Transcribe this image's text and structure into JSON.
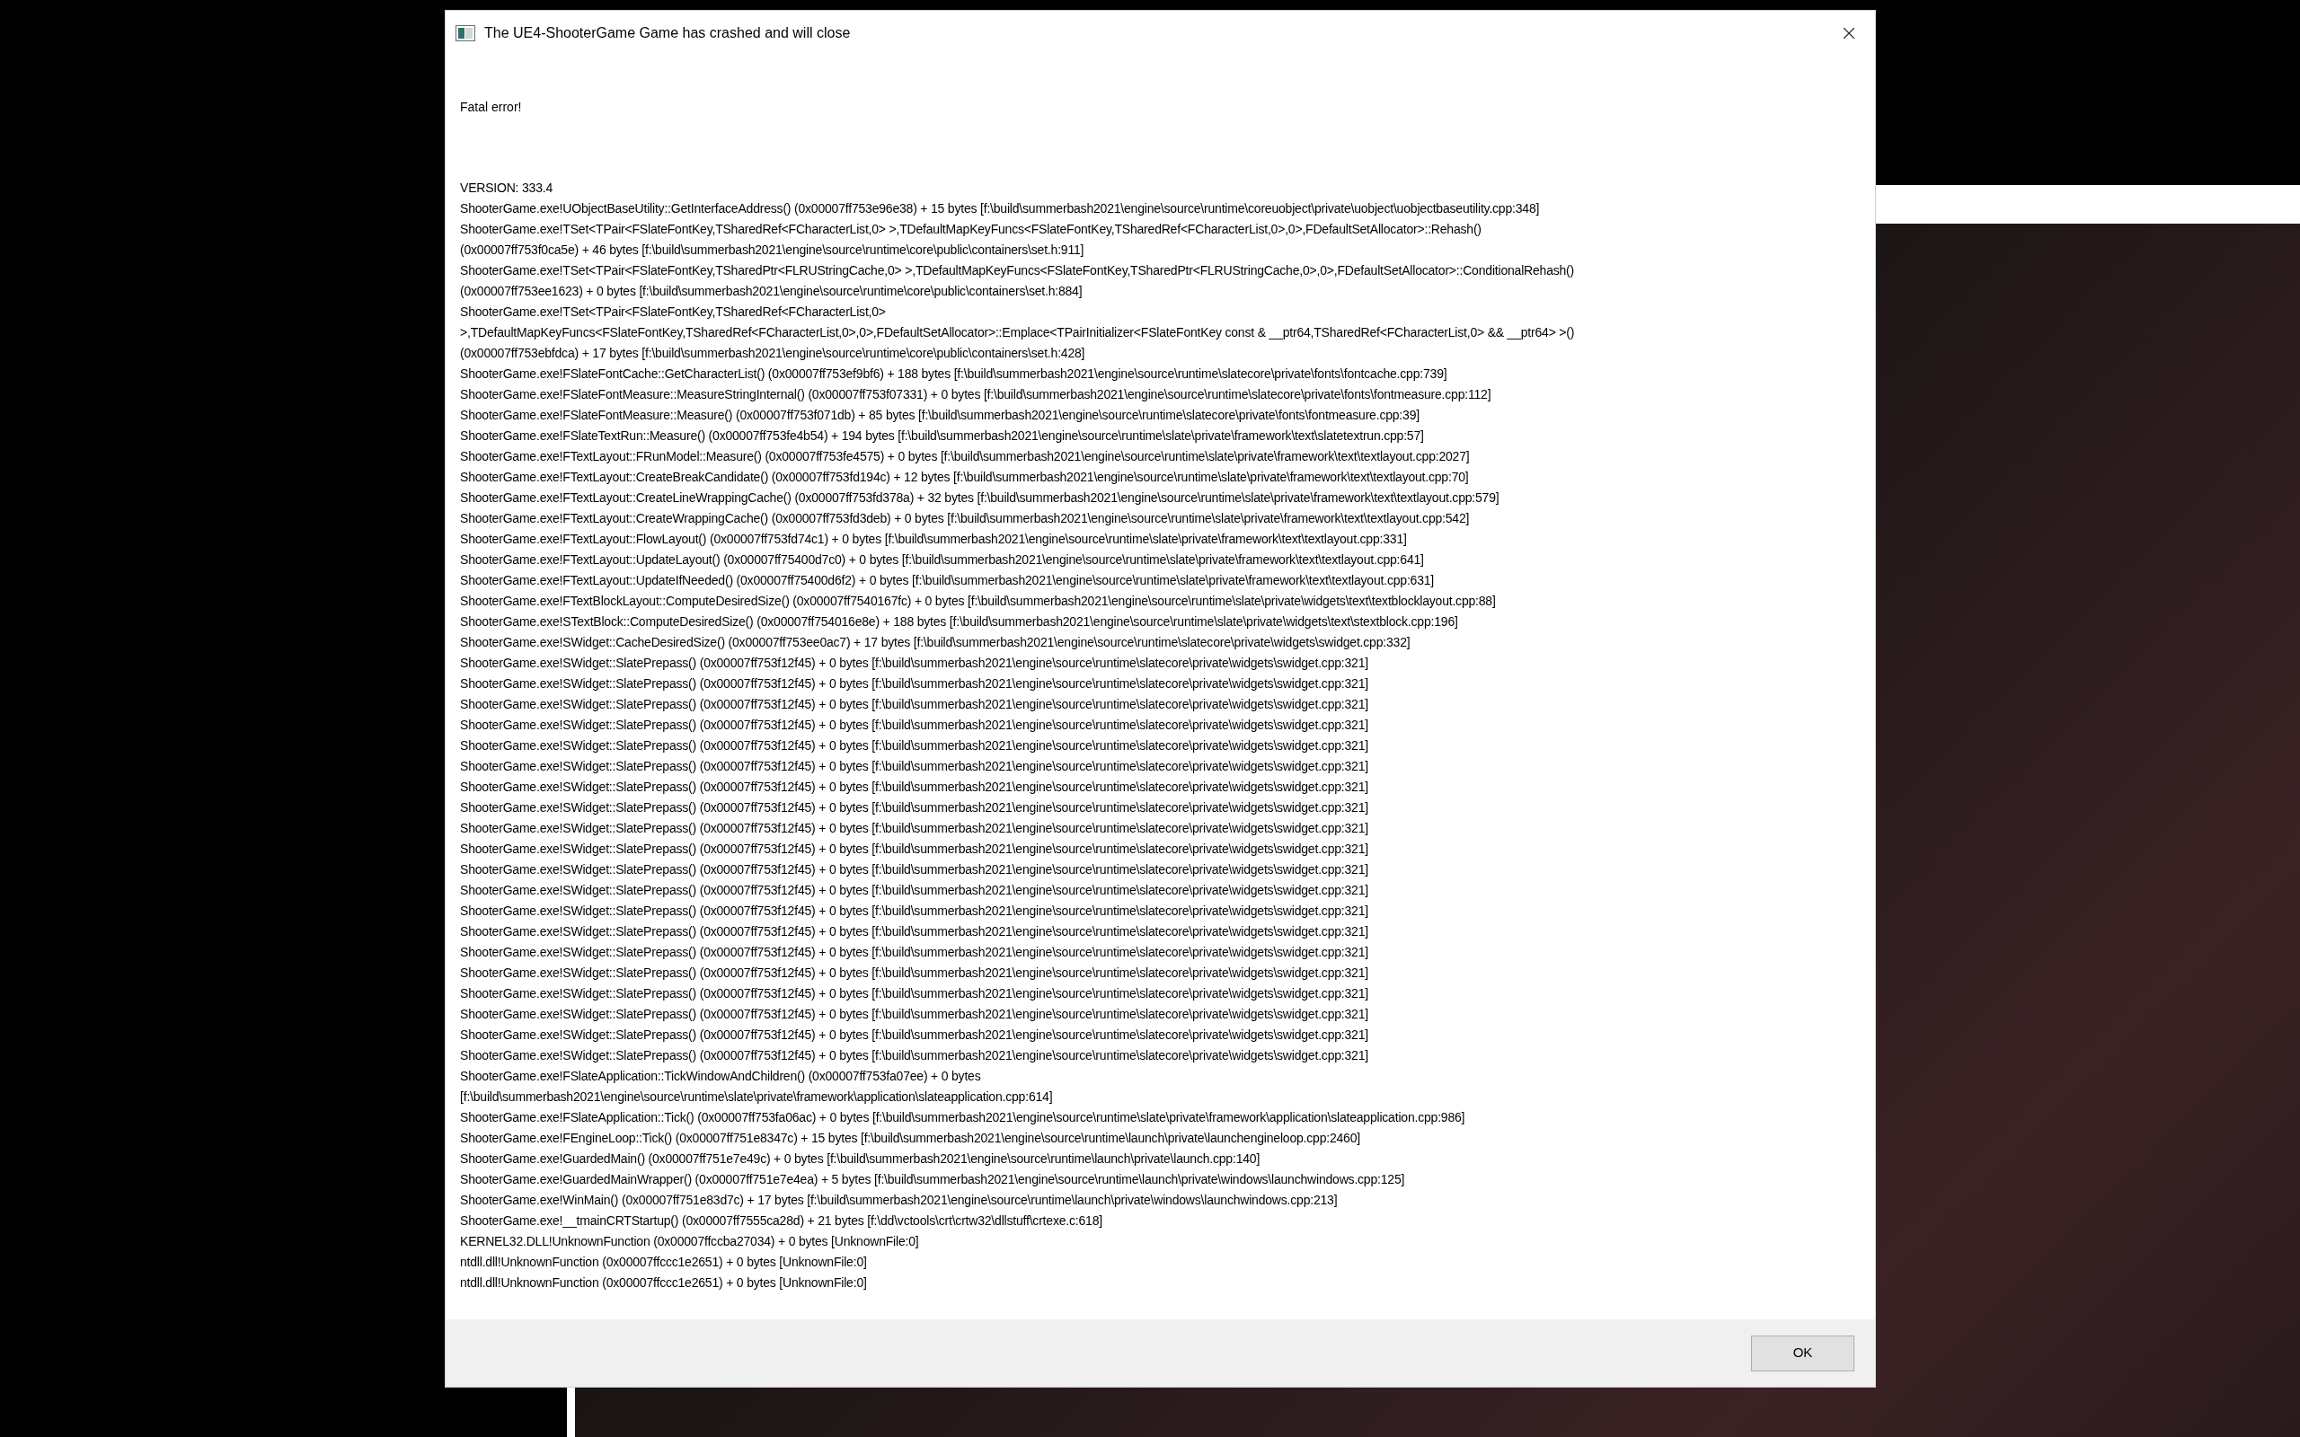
{
  "window": {
    "title": "The UE4-ShooterGame Game has crashed and will close"
  },
  "message": "Fatal error!",
  "lines": [
    "VERSION: 333.4",
    "ShooterGame.exe!UObjectBaseUtility::GetInterfaceAddress() (0x00007ff753e96e38) + 15 bytes [f:\\build\\summerbash2021\\engine\\source\\runtime\\coreuobject\\private\\uobject\\uobjectbaseutility.cpp:348]",
    "ShooterGame.exe!TSet<TPair<FSlateFontKey,TSharedRef<FCharacterList,0> >,TDefaultMapKeyFuncs<FSlateFontKey,TSharedRef<FCharacterList,0>,0>,FDefaultSetAllocator>::Rehash()",
    "(0x00007ff753f0ca5e) + 46 bytes [f:\\build\\summerbash2021\\engine\\source\\runtime\\core\\public\\containers\\set.h:911]",
    "ShooterGame.exe!TSet<TPair<FSlateFontKey,TSharedPtr<FLRUStringCache,0> >,TDefaultMapKeyFuncs<FSlateFontKey,TSharedPtr<FLRUStringCache,0>,0>,FDefaultSetAllocator>::ConditionalRehash()",
    "(0x00007ff753ee1623) + 0 bytes [f:\\build\\summerbash2021\\engine\\source\\runtime\\core\\public\\containers\\set.h:884]",
    "ShooterGame.exe!TSet<TPair<FSlateFontKey,TSharedRef<FCharacterList,0>",
    ">,TDefaultMapKeyFuncs<FSlateFontKey,TSharedRef<FCharacterList,0>,0>,FDefaultSetAllocator>::Emplace<TPairInitializer<FSlateFontKey const & __ptr64,TSharedRef<FCharacterList,0> && __ptr64> >()",
    "(0x00007ff753ebfdca) + 17 bytes [f:\\build\\summerbash2021\\engine\\source\\runtime\\core\\public\\containers\\set.h:428]",
    "ShooterGame.exe!FSlateFontCache::GetCharacterList() (0x00007ff753ef9bf6) + 188 bytes [f:\\build\\summerbash2021\\engine\\source\\runtime\\slatecore\\private\\fonts\\fontcache.cpp:739]",
    "ShooterGame.exe!FSlateFontMeasure::MeasureStringInternal() (0x00007ff753f07331) + 0 bytes [f:\\build\\summerbash2021\\engine\\source\\runtime\\slatecore\\private\\fonts\\fontmeasure.cpp:112]",
    "ShooterGame.exe!FSlateFontMeasure::Measure() (0x00007ff753f071db) + 85 bytes [f:\\build\\summerbash2021\\engine\\source\\runtime\\slatecore\\private\\fonts\\fontmeasure.cpp:39]",
    "ShooterGame.exe!FSlateTextRun::Measure() (0x00007ff753fe4b54) + 194 bytes [f:\\build\\summerbash2021\\engine\\source\\runtime\\slate\\private\\framework\\text\\slatetextrun.cpp:57]",
    "ShooterGame.exe!FTextLayout::FRunModel::Measure() (0x00007ff753fe4575) + 0 bytes [f:\\build\\summerbash2021\\engine\\source\\runtime\\slate\\private\\framework\\text\\textlayout.cpp:2027]",
    "ShooterGame.exe!FTextLayout::CreateBreakCandidate() (0x00007ff753fd194c) + 12 bytes [f:\\build\\summerbash2021\\engine\\source\\runtime\\slate\\private\\framework\\text\\textlayout.cpp:70]",
    "ShooterGame.exe!FTextLayout::CreateLineWrappingCache() (0x00007ff753fd378a) + 32 bytes [f:\\build\\summerbash2021\\engine\\source\\runtime\\slate\\private\\framework\\text\\textlayout.cpp:579]",
    "ShooterGame.exe!FTextLayout::CreateWrappingCache() (0x00007ff753fd3deb) + 0 bytes [f:\\build\\summerbash2021\\engine\\source\\runtime\\slate\\private\\framework\\text\\textlayout.cpp:542]",
    "ShooterGame.exe!FTextLayout::FlowLayout() (0x00007ff753fd74c1) + 0 bytes [f:\\build\\summerbash2021\\engine\\source\\runtime\\slate\\private\\framework\\text\\textlayout.cpp:331]",
    "ShooterGame.exe!FTextLayout::UpdateLayout() (0x00007ff75400d7c0) + 0 bytes [f:\\build\\summerbash2021\\engine\\source\\runtime\\slate\\private\\framework\\text\\textlayout.cpp:641]",
    "ShooterGame.exe!FTextLayout::UpdateIfNeeded() (0x00007ff75400d6f2) + 0 bytes [f:\\build\\summerbash2021\\engine\\source\\runtime\\slate\\private\\framework\\text\\textlayout.cpp:631]",
    "ShooterGame.exe!FTextBlockLayout::ComputeDesiredSize() (0x00007ff7540167fc) + 0 bytes [f:\\build\\summerbash2021\\engine\\source\\runtime\\slate\\private\\widgets\\text\\textblocklayout.cpp:88]",
    "ShooterGame.exe!STextBlock::ComputeDesiredSize() (0x00007ff754016e8e) + 188 bytes [f:\\build\\summerbash2021\\engine\\source\\runtime\\slate\\private\\widgets\\text\\stextblock.cpp:196]",
    "ShooterGame.exe!SWidget::CacheDesiredSize() (0x00007ff753ee0ac7) + 17 bytes [f:\\build\\summerbash2021\\engine\\source\\runtime\\slatecore\\private\\widgets\\swidget.cpp:332]",
    "ShooterGame.exe!SWidget::SlatePrepass() (0x00007ff753f12f45) + 0 bytes [f:\\build\\summerbash2021\\engine\\source\\runtime\\slatecore\\private\\widgets\\swidget.cpp:321]",
    "ShooterGame.exe!SWidget::SlatePrepass() (0x00007ff753f12f45) + 0 bytes [f:\\build\\summerbash2021\\engine\\source\\runtime\\slatecore\\private\\widgets\\swidget.cpp:321]",
    "ShooterGame.exe!SWidget::SlatePrepass() (0x00007ff753f12f45) + 0 bytes [f:\\build\\summerbash2021\\engine\\source\\runtime\\slatecore\\private\\widgets\\swidget.cpp:321]",
    "ShooterGame.exe!SWidget::SlatePrepass() (0x00007ff753f12f45) + 0 bytes [f:\\build\\summerbash2021\\engine\\source\\runtime\\slatecore\\private\\widgets\\swidget.cpp:321]",
    "ShooterGame.exe!SWidget::SlatePrepass() (0x00007ff753f12f45) + 0 bytes [f:\\build\\summerbash2021\\engine\\source\\runtime\\slatecore\\private\\widgets\\swidget.cpp:321]",
    "ShooterGame.exe!SWidget::SlatePrepass() (0x00007ff753f12f45) + 0 bytes [f:\\build\\summerbash2021\\engine\\source\\runtime\\slatecore\\private\\widgets\\swidget.cpp:321]",
    "ShooterGame.exe!SWidget::SlatePrepass() (0x00007ff753f12f45) + 0 bytes [f:\\build\\summerbash2021\\engine\\source\\runtime\\slatecore\\private\\widgets\\swidget.cpp:321]",
    "ShooterGame.exe!SWidget::SlatePrepass() (0x00007ff753f12f45) + 0 bytes [f:\\build\\summerbash2021\\engine\\source\\runtime\\slatecore\\private\\widgets\\swidget.cpp:321]",
    "ShooterGame.exe!SWidget::SlatePrepass() (0x00007ff753f12f45) + 0 bytes [f:\\build\\summerbash2021\\engine\\source\\runtime\\slatecore\\private\\widgets\\swidget.cpp:321]",
    "ShooterGame.exe!SWidget::SlatePrepass() (0x00007ff753f12f45) + 0 bytes [f:\\build\\summerbash2021\\engine\\source\\runtime\\slatecore\\private\\widgets\\swidget.cpp:321]",
    "ShooterGame.exe!SWidget::SlatePrepass() (0x00007ff753f12f45) + 0 bytes [f:\\build\\summerbash2021\\engine\\source\\runtime\\slatecore\\private\\widgets\\swidget.cpp:321]",
    "ShooterGame.exe!SWidget::SlatePrepass() (0x00007ff753f12f45) + 0 bytes [f:\\build\\summerbash2021\\engine\\source\\runtime\\slatecore\\private\\widgets\\swidget.cpp:321]",
    "ShooterGame.exe!SWidget::SlatePrepass() (0x00007ff753f12f45) + 0 bytes [f:\\build\\summerbash2021\\engine\\source\\runtime\\slatecore\\private\\widgets\\swidget.cpp:321]",
    "ShooterGame.exe!SWidget::SlatePrepass() (0x00007ff753f12f45) + 0 bytes [f:\\build\\summerbash2021\\engine\\source\\runtime\\slatecore\\private\\widgets\\swidget.cpp:321]",
    "ShooterGame.exe!SWidget::SlatePrepass() (0x00007ff753f12f45) + 0 bytes [f:\\build\\summerbash2021\\engine\\source\\runtime\\slatecore\\private\\widgets\\swidget.cpp:321]",
    "ShooterGame.exe!SWidget::SlatePrepass() (0x00007ff753f12f45) + 0 bytes [f:\\build\\summerbash2021\\engine\\source\\runtime\\slatecore\\private\\widgets\\swidget.cpp:321]",
    "ShooterGame.exe!SWidget::SlatePrepass() (0x00007ff753f12f45) + 0 bytes [f:\\build\\summerbash2021\\engine\\source\\runtime\\slatecore\\private\\widgets\\swidget.cpp:321]",
    "ShooterGame.exe!SWidget::SlatePrepass() (0x00007ff753f12f45) + 0 bytes [f:\\build\\summerbash2021\\engine\\source\\runtime\\slatecore\\private\\widgets\\swidget.cpp:321]",
    "ShooterGame.exe!SWidget::SlatePrepass() (0x00007ff753f12f45) + 0 bytes [f:\\build\\summerbash2021\\engine\\source\\runtime\\slatecore\\private\\widgets\\swidget.cpp:321]",
    "ShooterGame.exe!SWidget::SlatePrepass() (0x00007ff753f12f45) + 0 bytes [f:\\build\\summerbash2021\\engine\\source\\runtime\\slatecore\\private\\widgets\\swidget.cpp:321]",
    "ShooterGame.exe!FSlateApplication::TickWindowAndChildren() (0x00007ff753fa07ee) + 0 bytes",
    "[f:\\build\\summerbash2021\\engine\\source\\runtime\\slate\\private\\framework\\application\\slateapplication.cpp:614]",
    "ShooterGame.exe!FSlateApplication::Tick() (0x00007ff753fa06ac) + 0 bytes [f:\\build\\summerbash2021\\engine\\source\\runtime\\slate\\private\\framework\\application\\slateapplication.cpp:986]",
    "ShooterGame.exe!FEngineLoop::Tick() (0x00007ff751e8347c) + 15 bytes [f:\\build\\summerbash2021\\engine\\source\\runtime\\launch\\private\\launchengineloop.cpp:2460]",
    "ShooterGame.exe!GuardedMain() (0x00007ff751e7e49c) + 0 bytes [f:\\build\\summerbash2021\\engine\\source\\runtime\\launch\\private\\launch.cpp:140]",
    "ShooterGame.exe!GuardedMainWrapper() (0x00007ff751e7e4ea) + 5 bytes [f:\\build\\summerbash2021\\engine\\source\\runtime\\launch\\private\\windows\\launchwindows.cpp:125]",
    "ShooterGame.exe!WinMain() (0x00007ff751e83d7c) + 17 bytes [f:\\build\\summerbash2021\\engine\\source\\runtime\\launch\\private\\windows\\launchwindows.cpp:213]",
    "ShooterGame.exe!__tmainCRTStartup() (0x00007ff7555ca28d) + 21 bytes [f:\\dd\\vctools\\crt\\crtw32\\dllstuff\\crtexe.c:618]",
    "KERNEL32.DLL!UnknownFunction (0x00007ffccba27034) + 0 bytes [UnknownFile:0]",
    "ntdll.dll!UnknownFunction (0x00007ffccc1e2651) + 0 bytes [UnknownFile:0]",
    "ntdll.dll!UnknownFunction (0x00007ffccc1e2651) + 0 bytes [UnknownFile:0]"
  ],
  "buttons": [
    "OK"
  ]
}
